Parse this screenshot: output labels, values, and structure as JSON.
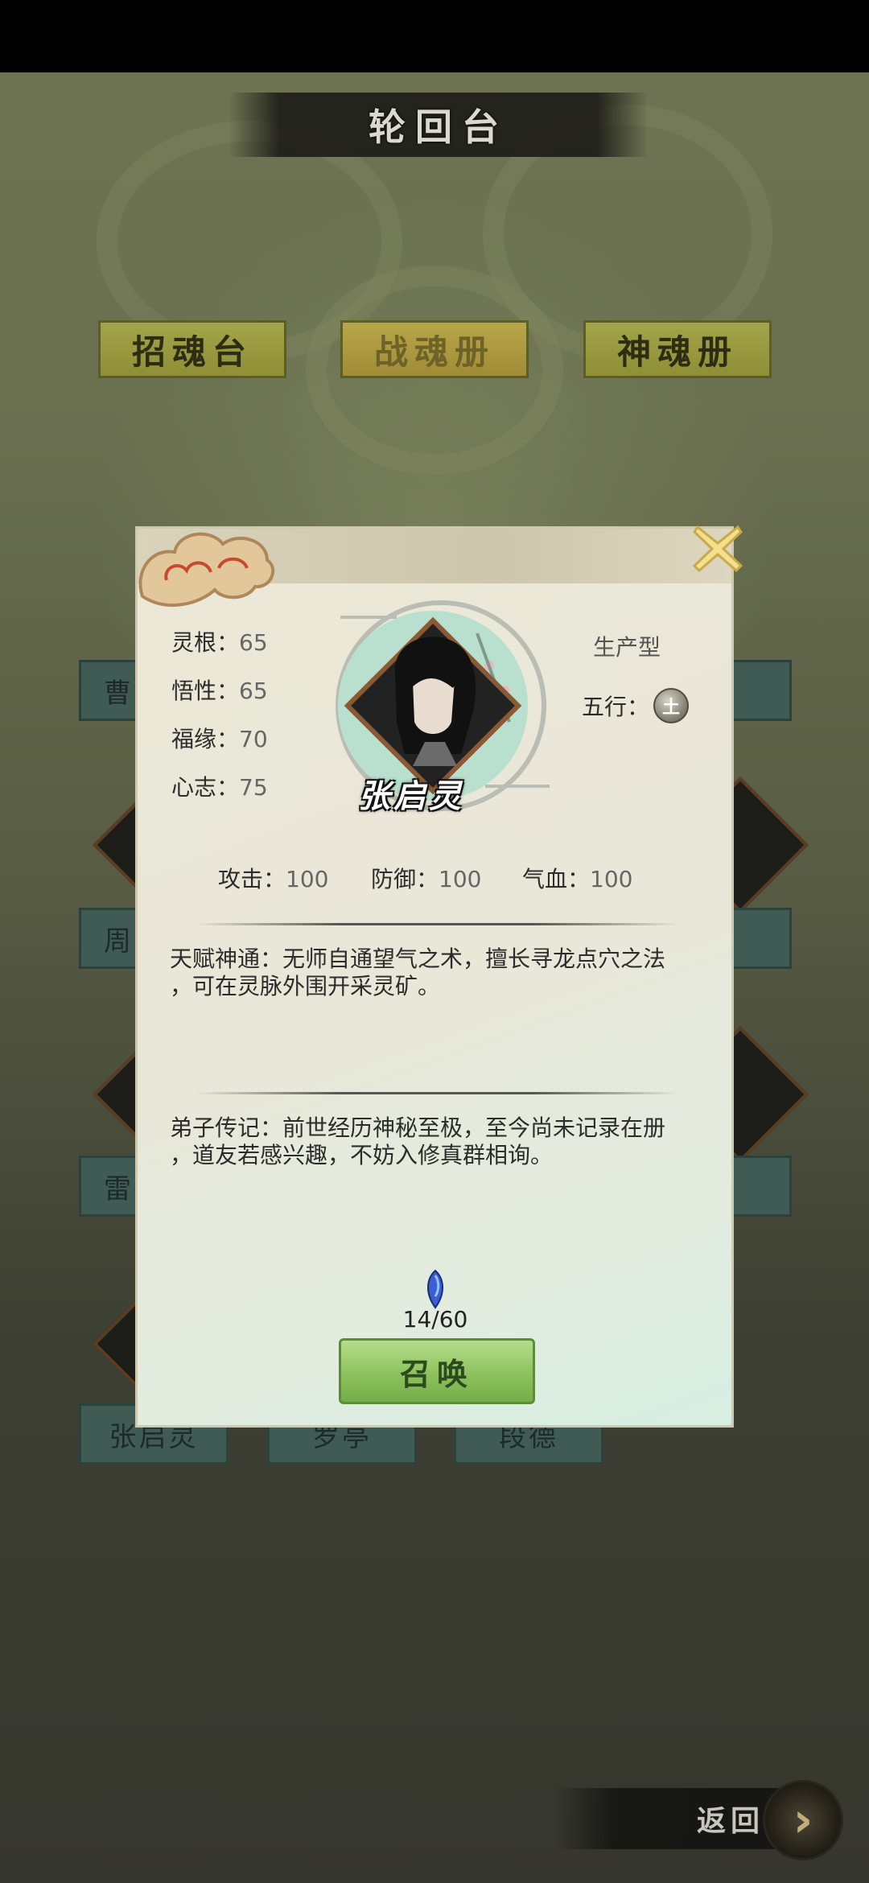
{
  "header": {
    "title": "轮回台"
  },
  "tabs": [
    {
      "label": "招魂台",
      "active": false
    },
    {
      "label": "战魂册",
      "active": true
    },
    {
      "label": "神魂册",
      "active": false
    }
  ],
  "background_cards": [
    {
      "label": "曹"
    },
    {
      "label": "周"
    },
    {
      "label": "雷"
    },
    {
      "label": "张启灵"
    },
    {
      "label": "罗亭"
    },
    {
      "label": "段德"
    }
  ],
  "dialog": {
    "character_name": "张启灵",
    "type": "生产型",
    "element_label": "五行：",
    "element_value": "土",
    "stats": [
      {
        "label": "灵根：",
        "value": "65"
      },
      {
        "label": "悟性：",
        "value": "65"
      },
      {
        "label": "福缘：",
        "value": "70"
      },
      {
        "label": "心志：",
        "value": "75"
      }
    ],
    "combat": [
      {
        "label": "攻击：",
        "value": "100"
      },
      {
        "label": "防御：",
        "value": "100"
      },
      {
        "label": "气血：",
        "value": "100"
      }
    ],
    "talent": {
      "line1": "天赋神通：无师自通望气之术，擅长寻龙点穴之法",
      "line2": "，可在灵脉外围开采灵矿。"
    },
    "biography": {
      "line1": "弟子传记：前世经历神秘至极，至今尚未记录在册",
      "line2": "，道友若感兴趣，不妨入修真群相询。"
    },
    "gem_count": "14/60",
    "summon_label": "召唤"
  },
  "footer": {
    "return_label": "返回"
  }
}
